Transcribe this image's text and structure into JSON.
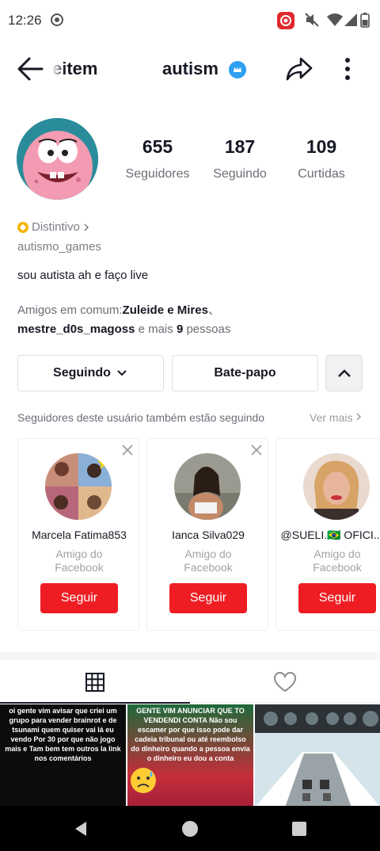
{
  "status_bar": {
    "time": "12:26",
    "icons": [
      "debug-icon",
      "screen-record-icon",
      "mute-icon",
      "wifi-icon",
      "signal-icon",
      "battery-icon"
    ]
  },
  "header": {
    "previous_user": "eitem",
    "username": "autism",
    "icons": [
      "back-arrow-icon",
      "verified-icon",
      "share-icon",
      "more-vertical-icon"
    ]
  },
  "profile": {
    "stats": [
      {
        "value": "655",
        "label": "Seguidores"
      },
      {
        "value": "187",
        "label": "Seguindo"
      },
      {
        "value": "109",
        "label": "Curtidas"
      }
    ],
    "badge_label": "Distintivo",
    "handle": "autismo_games",
    "bio": "sou autista ah e faço live",
    "mutual": {
      "prefix": "Amigos em comum:",
      "name1": "Zuleide e Mires",
      "sep": "、",
      "name2": "mestre_d0s_magoss",
      "middle": " e mais ",
      "count": "9",
      "suffix": " pessoas"
    }
  },
  "actions": {
    "following": "Seguindo",
    "chat": "Bate-papo"
  },
  "suggestions": {
    "title": "Seguidores deste usuário também estão seguindo",
    "see_more": "Ver mais",
    "cards": [
      {
        "name": "Marcela Fatima853",
        "subtitle": "Amigo do Facebook",
        "follow": "Seguir"
      },
      {
        "name": "Ianca Silva029",
        "subtitle": "Amigo do Facebook",
        "follow": "Seguir"
      },
      {
        "name": "@SUELI.🇧🇷 OFICI...",
        "subtitle": "Amigo do Facebook",
        "follow": "Seguir"
      }
    ]
  },
  "tabs": [
    "videos-grid-icon",
    "liked-heart-icon"
  ],
  "thumbnails": [
    {
      "caption": "oi gente vim avisar que criei um grupo para vender brainrot e de tsunami quem quiser vai lá eu vendo Por 30 por que não jogo mais e Tam bem tem outros la link nos comentários"
    },
    {
      "caption": "GENTE VIM ANUNCIAR QUE TO VENDENDI CONTA Não sou escamer por que isso pode dar cadeia tribunal ou até reembolso do dinheiro quando a pessoa envia o dinheiro eu dou a conta"
    },
    {
      "caption": ""
    }
  ],
  "colors": {
    "accent": "#ee1d23",
    "verified": "#2fa0f0",
    "badge": "#f5b400"
  }
}
